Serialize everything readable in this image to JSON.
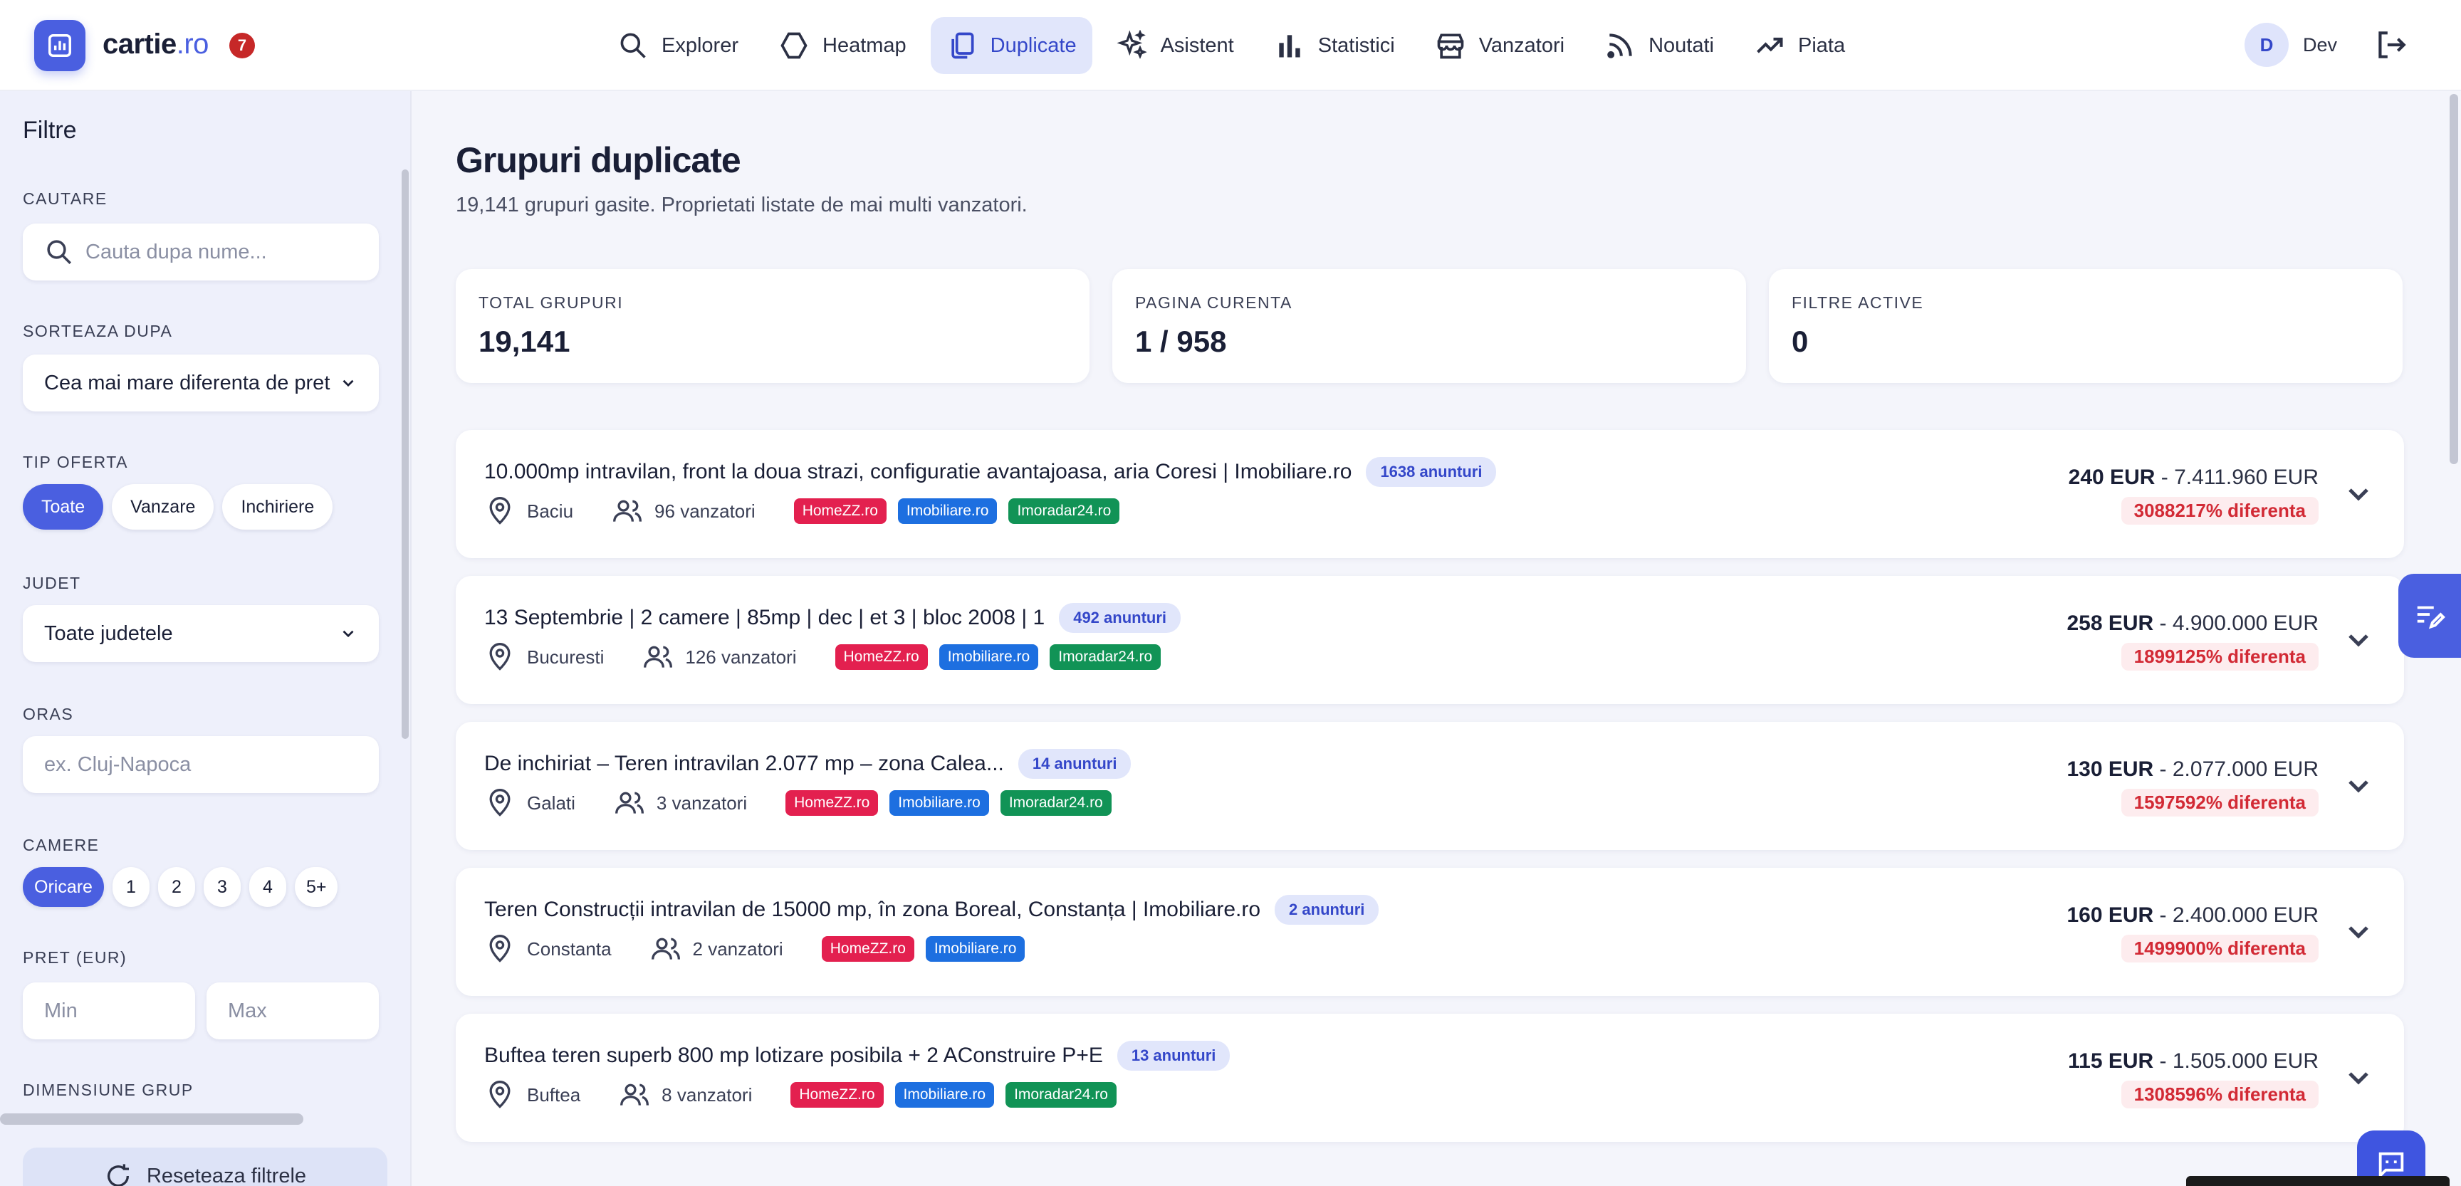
{
  "header": {
    "brand_name": "cartie",
    "brand_tld": ".ro",
    "notification_count": "7",
    "nav": [
      {
        "label": "Explorer",
        "icon": "search-icon"
      },
      {
        "label": "Heatmap",
        "icon": "hexagon-icon"
      },
      {
        "label": "Duplicate",
        "icon": "copy-icon",
        "active": true
      },
      {
        "label": "Asistent",
        "icon": "sparkles-icon"
      },
      {
        "label": "Statistici",
        "icon": "bar-chart-icon"
      },
      {
        "label": "Vanzatori",
        "icon": "store-icon"
      },
      {
        "label": "Noutati",
        "icon": "rss-icon"
      },
      {
        "label": "Piata",
        "icon": "trending-up-icon"
      }
    ],
    "user_initial": "D",
    "user_name": "Dev"
  },
  "sidebar": {
    "title": "Filtre",
    "search": {
      "label": "CAUTARE",
      "placeholder": "Cauta dupa nume..."
    },
    "sort": {
      "label": "SORTEAZA DUPA",
      "value": "Cea mai mare diferenta de pret"
    },
    "offer_type": {
      "label": "TIP OFERTA",
      "options": [
        "Toate",
        "Vanzare",
        "Inchiriere"
      ],
      "selected": "Toate"
    },
    "county": {
      "label": "JUDET",
      "value": "Toate judetele"
    },
    "city": {
      "label": "ORAS",
      "placeholder": "ex. Cluj-Napoca"
    },
    "rooms": {
      "label": "CAMERE",
      "options": [
        "Oricare",
        "1",
        "2",
        "3",
        "4",
        "5+"
      ],
      "selected": "Oricare"
    },
    "price": {
      "label": "PRET (EUR)",
      "min_placeholder": "Min",
      "max_placeholder": "Max"
    },
    "group_size": {
      "label": "DIMENSIUNE GRUP"
    },
    "reset_label": "Reseteaza filtrele"
  },
  "main": {
    "title": "Grupuri duplicate",
    "subtitle": "19,141 grupuri gasite. Proprietati listate de mai multi vanzatori.",
    "stats": [
      {
        "label": "TOTAL GRUPURI",
        "value": "19,141"
      },
      {
        "label": "PAGINA CURENTA",
        "value": "1 / 958"
      },
      {
        "label": "FILTRE ACTIVE",
        "value": "0"
      }
    ],
    "groups": [
      {
        "title": "10.000mp intravilan, front la doua strazi, configuratie avantajoasa, aria Coresi | Imobiliare.ro",
        "count": "1638 anunturi",
        "location": "Baciu",
        "sellers": "96 vanzatori",
        "sources": [
          "HomeZZ.ro",
          "Imobiliare.ro",
          "Imoradar24.ro"
        ],
        "price_min": "240 EUR",
        "price_max": "7.411.960 EUR",
        "diff": "3088217% diferenta"
      },
      {
        "title": "13 Septembrie | 2 camere | 85mp | dec | et 3 | bloc 2008 | 1",
        "count": "492 anunturi",
        "location": "Bucuresti",
        "sellers": "126 vanzatori",
        "sources": [
          "HomeZZ.ro",
          "Imobiliare.ro",
          "Imoradar24.ro"
        ],
        "price_min": "258 EUR",
        "price_max": "4.900.000 EUR",
        "diff": "1899125% diferenta"
      },
      {
        "title": "De inchiriat – Teren intravilan 2.077 mp – zona Calea...",
        "count": "14 anunturi",
        "location": "Galati",
        "sellers": "3 vanzatori",
        "sources": [
          "HomeZZ.ro",
          "Imobiliare.ro",
          "Imoradar24.ro"
        ],
        "price_min": "130 EUR",
        "price_max": "2.077.000 EUR",
        "diff": "1597592% diferenta"
      },
      {
        "title": "Teren Construcții intravilan de 15000 mp, în zona Boreal, Constanța | Imobiliare.ro",
        "count": "2 anunturi",
        "location": "Constanta",
        "sellers": "2 vanzatori",
        "sources": [
          "HomeZZ.ro",
          "Imobiliare.ro"
        ],
        "price_min": "160 EUR",
        "price_max": "2.400.000 EUR",
        "diff": "1499900% diferenta"
      },
      {
        "title": "Buftea teren superb 800 mp lotizare posibila + 2 AConstruire P+E",
        "count": "13 anunturi",
        "location": "Buftea",
        "sellers": "8 vanzatori",
        "sources": [
          "HomeZZ.ro",
          "Imobiliare.ro",
          "Imoradar24.ro"
        ],
        "price_min": "115 EUR",
        "price_max": "1.505.000 EUR",
        "diff": "1308596% diferenta"
      }
    ]
  },
  "colors": {
    "accent": "#4a5fe0",
    "homezz": "#e3204f",
    "imobiliare": "#1d6fe0",
    "imoradar": "#119356",
    "diff_text": "#d22a35"
  }
}
